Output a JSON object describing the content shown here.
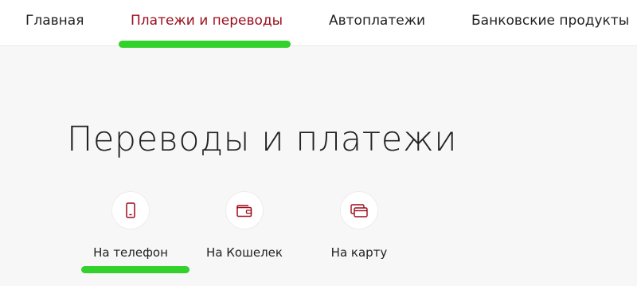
{
  "nav": {
    "items": [
      {
        "label": "Главная"
      },
      {
        "label": "Платежи и переводы",
        "active": true
      },
      {
        "label": "Автоплатежи"
      },
      {
        "label": "Банковские продукты"
      }
    ]
  },
  "main": {
    "title": "Переводы и платежи",
    "options": [
      {
        "label": "На телефон",
        "icon": "phone-icon"
      },
      {
        "label": "На Кошелек",
        "icon": "wallet-icon"
      },
      {
        "label": "На карту",
        "icon": "cards-icon"
      }
    ]
  },
  "colors": {
    "accent": "#9b0d1d",
    "highlight": "#33d12b",
    "background": "#f7f7f7"
  }
}
